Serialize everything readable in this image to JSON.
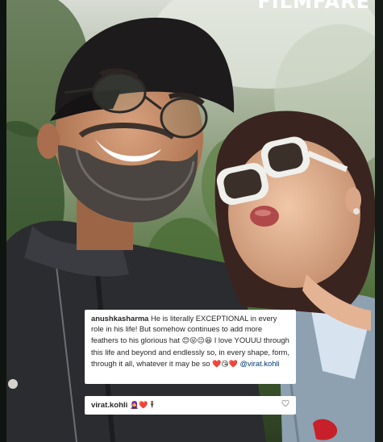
{
  "masthead": "FILMFARE",
  "comment": {
    "username": "anushkasharma",
    "text": "He is literally EXCEPTIONAL in every role in his life! But somehow continues to add more feathers to his glorious hat",
    "text2": "I love YOUUU through this life and beyond and endlessly so, in every shape, form, through it all, whatever it may be so",
    "emojis_1": "😊😜😉😆",
    "emojis_2": "❤️😘❤️",
    "mention": "@virat.kohli"
  },
  "reply": {
    "username": "virat.kohli",
    "emojis": "🧕❤️🕴",
    "like_icon": "heart-outline-icon"
  },
  "colors": {
    "card_background": "#ffffff",
    "text": "#262626",
    "mention": "#00376b",
    "heart": "#ed4956"
  }
}
